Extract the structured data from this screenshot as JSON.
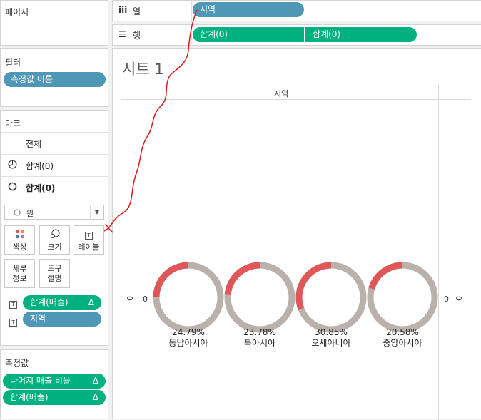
{
  "pages_panel": {
    "title": "페이지"
  },
  "shelves": {
    "columns": {
      "icon": "iii",
      "label": "열",
      "pills": [
        "지역"
      ]
    },
    "rows": {
      "icon": "☰",
      "label": "행",
      "pills": [
        "합계(0)",
        "합계(0)"
      ]
    }
  },
  "filters": {
    "title": "필터",
    "pills": [
      "측정값 이름"
    ]
  },
  "marks": {
    "title": "마크",
    "rows": [
      {
        "label": "전체",
        "icon": ""
      },
      {
        "label": "합계(0)",
        "icon": "pie-icon"
      },
      {
        "label": "합계(0)",
        "icon": "circle-icon"
      }
    ],
    "mark_type": "원",
    "tiles": [
      {
        "label": "색상",
        "icon": "color-dots-icon"
      },
      {
        "label": "크기",
        "icon": "size-icon"
      },
      {
        "label": "레이블",
        "icon": "label-icon"
      },
      {
        "label": "세부\n정보",
        "icon": "detail-icon"
      },
      {
        "label": "도구\n설명",
        "icon": "tooltip-icon"
      }
    ],
    "fields": [
      {
        "label": "합계(매출)",
        "delta": "Δ",
        "color": "#00b180"
      },
      {
        "label": "지역",
        "delta": "",
        "color": "#4e98b5"
      }
    ]
  },
  "measures": {
    "title": "측정값",
    "pills": [
      {
        "label": "나머지 매출 비율",
        "delta": "Δ"
      },
      {
        "label": "합계(매출)",
        "delta": "Δ"
      }
    ]
  },
  "sheet": {
    "title": "시트 1",
    "header": "지역",
    "axis_left": "0",
    "axis_right": "0",
    "colors": {
      "share": "#e05759",
      "rest": "#bab0ac"
    }
  },
  "chart_data": {
    "type": "pie",
    "categories": [
      "동남아시아",
      "북아시아",
      "오세아니아",
      "중앙아시아"
    ],
    "values": [
      24.79,
      23.78,
      30.85,
      20.58
    ],
    "labels": [
      "24.79%",
      "23.78%",
      "30.85%",
      "20.58%"
    ],
    "title": "시트 1",
    "xlabel": "지역",
    "ylabel": "0"
  }
}
